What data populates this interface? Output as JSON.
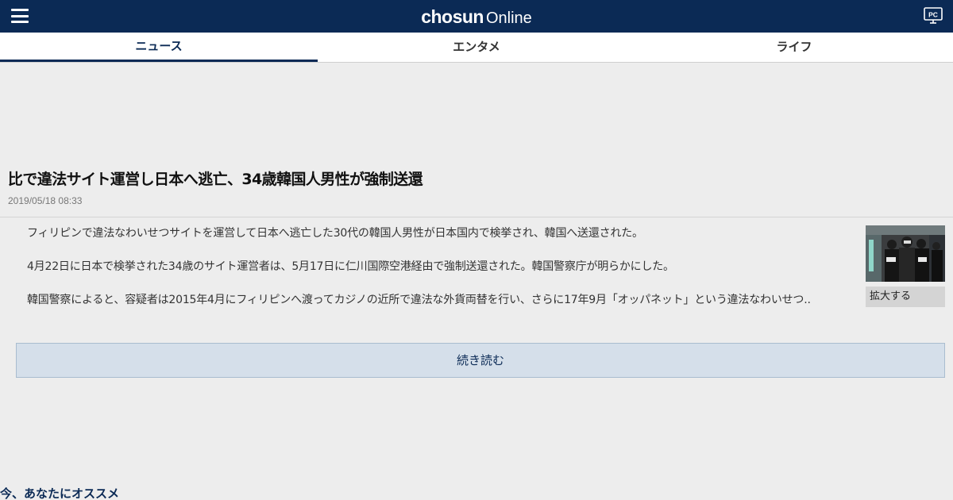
{
  "header": {
    "brand": "chosun",
    "brand_sub": "Online",
    "pc_label": "PC"
  },
  "tabs": [
    {
      "label": "ニュース",
      "active": true
    },
    {
      "label": "エンタメ",
      "active": false
    },
    {
      "label": "ライフ",
      "active": false
    }
  ],
  "article": {
    "title": "比で違法サイト運営し日本へ逃亡、34歳韓国人男性が強制送還",
    "date": "2019/05/18 08:33",
    "paragraphs": [
      "フィリピンで違法なわいせつサイトを運営して日本へ逃亡した30代の韓国人男性が日本国内で検挙され、韓国へ送還された。",
      "4月22日に日本で検挙された34歳のサイト運営者は、5月17日に仁川国際空港経由で強制送還された。韓国警察庁が明らかにした。",
      "韓国警察によると、容疑者は2015年4月にフィリピンへ渡ってカジノの近所で違法な外貨両替を行い、さらに17年9月「オッパネット」という違法なわいせつ.."
    ],
    "enlarge_label": "拡大する",
    "read_more_label": "続き読む"
  },
  "recommend": {
    "title": "今、あなたにオススメ"
  },
  "colors": {
    "header_bg": "#0b2a55",
    "page_bg": "#ededed",
    "read_more_bg": "#d5dfea",
    "accent": "#0b2a55"
  }
}
